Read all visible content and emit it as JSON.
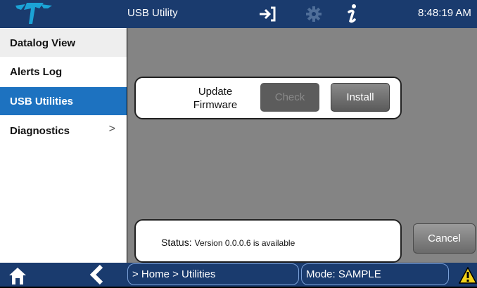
{
  "header": {
    "title": "USB Utility",
    "time": "8:48:19 AM"
  },
  "icons": {
    "logo": "logo-icon",
    "login": "sign-in-icon",
    "settings": "gear-icon",
    "info": "info-icon",
    "home": "home-icon",
    "back": "back-icon",
    "warning": "warning-icon"
  },
  "sidebar": {
    "items": [
      {
        "label": "Datalog View"
      },
      {
        "label": "Alerts Log"
      },
      {
        "label": "USB Utilities"
      },
      {
        "label": "Diagnostics",
        "chevron": ">"
      }
    ]
  },
  "firmware": {
    "label_line1": "Update",
    "label_line2": "Firmware",
    "check_label": "Check",
    "install_label": "Install"
  },
  "status": {
    "prefix": "Status:",
    "text": "Version 0.0.0.6 is available"
  },
  "cancel_label": "Cancel",
  "footer": {
    "breadcrumb": "> Home > Utilities",
    "mode": "Mode: SAMPLE"
  },
  "colors": {
    "bar": "#1a3b6e",
    "active": "#1d72c0",
    "content": "#848484",
    "warning": "#f2d21b"
  }
}
